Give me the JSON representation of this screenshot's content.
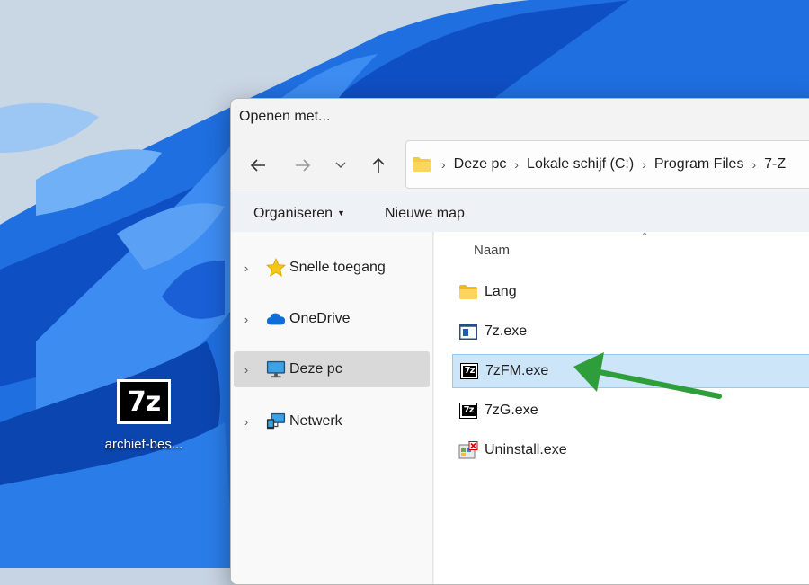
{
  "desktop": {
    "icon_glyph": "7z",
    "icon_label": "archief-bes..."
  },
  "dialog": {
    "title": "Openen met...",
    "address": [
      "Deze pc",
      "Lokale schijf (C:)",
      "Program Files",
      "7-Z"
    ],
    "toolbar": {
      "organize": "Organiseren",
      "new_folder": "Nieuwe map"
    },
    "sidebar": [
      {
        "label": "Snelle toegang",
        "icon": "star-icon",
        "selected": false
      },
      {
        "label": "OneDrive",
        "icon": "cloud-icon",
        "selected": false
      },
      {
        "label": "Deze pc",
        "icon": "computer-icon",
        "selected": true
      },
      {
        "label": "Netwerk",
        "icon": "network-icon",
        "selected": false
      }
    ],
    "column_header": "Naam",
    "files": [
      {
        "name": "Lang",
        "icon": "folder-icon",
        "selected": false
      },
      {
        "name": "7z.exe",
        "icon": "console-exe-icon",
        "selected": false
      },
      {
        "name": "7zFM.exe",
        "icon": "7zip-icon",
        "selected": true
      },
      {
        "name": "7zG.exe",
        "icon": "7zip-icon",
        "selected": false
      },
      {
        "name": "Uninstall.exe",
        "icon": "uninstall-icon",
        "selected": false
      }
    ]
  },
  "colors": {
    "selection_bg": "#cde5f8",
    "selection_border": "#99c9ef",
    "annotation_arrow": "#2e9e3b",
    "folder_yellow": "#f7c948"
  }
}
